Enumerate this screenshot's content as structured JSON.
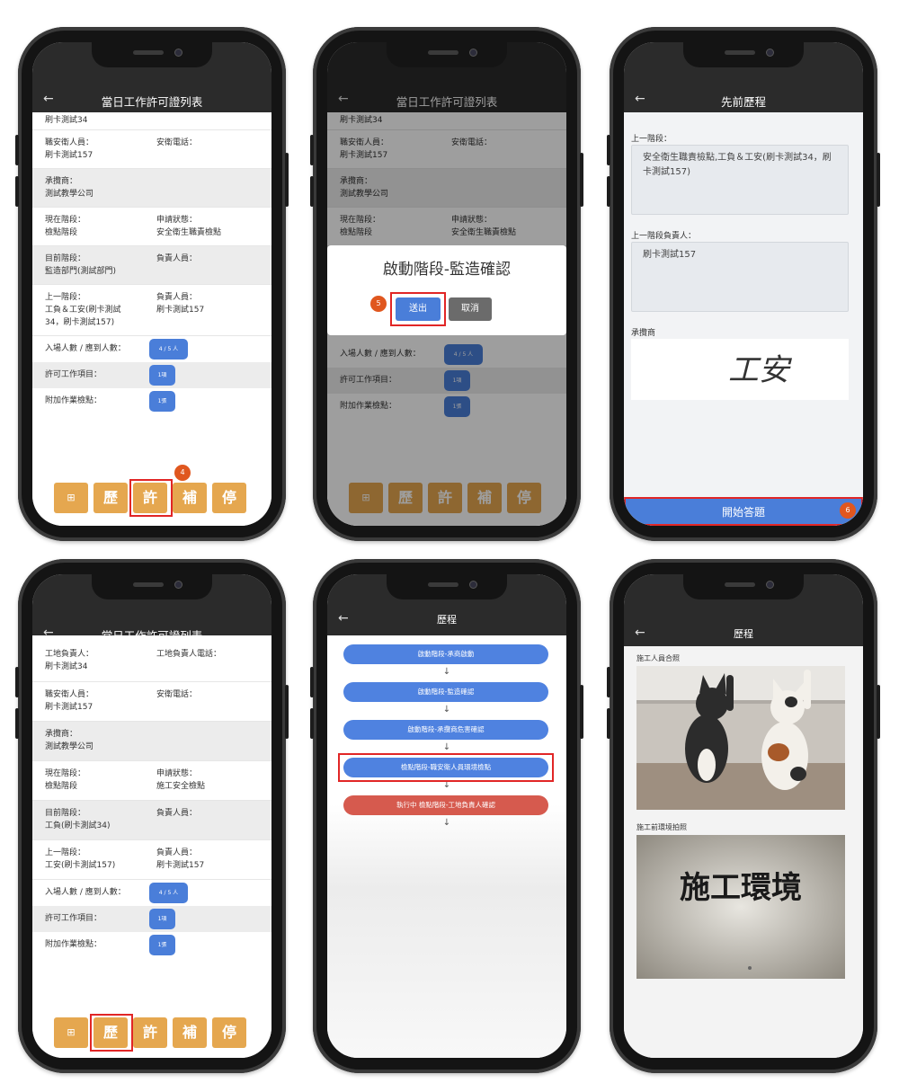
{
  "colors": {
    "accent": "#4a7ed9",
    "toolbar": "#e5a74f",
    "highlight": "#e12626",
    "badge": "#e0571f",
    "danger": "#d65a4e",
    "appbar": "#2b2b2b"
  },
  "common": {
    "back_icon": "←"
  },
  "toolbar": {
    "grid_icon": "⊞",
    "history": "歷",
    "permit": "許",
    "supplement": "補",
    "stop": "停"
  },
  "s1": {
    "title": "當日工作許可證列表",
    "first_line": "刷卡測試34",
    "safety_person_label": "職安衛人員：",
    "safety_person_value": "刷卡測試157",
    "safety_phone_label": "安衛電話：",
    "contractor_label": "承攬商：",
    "contractor_value": "測試教學公司",
    "current_stage_label": "現在階段：",
    "current_stage_value": "檢點階段",
    "apply_status_label": "申請狀態：",
    "apply_status_value": "安全衛生職責檢點",
    "target_stage_label": "目前階段：",
    "target_stage_value": "監造部門(測試部門)",
    "owner_label": "負責人員：",
    "prev_stage_label": "上一階段：",
    "prev_stage_value_1": "工負＆工安(刷卡測試",
    "prev_stage_value_2": "34，刷卡測試157)",
    "prev_owner_label": "負責人員：",
    "prev_owner_value": "刷卡測試157",
    "attendance_label": "入場人數 / 應到人數：",
    "attendance_value": "4 / 5 人",
    "permit_items_label": "許可工作項目：",
    "permit_items_value": "1項",
    "extra_check_label": "附加作業檢點：",
    "extra_check_value": "1張",
    "badge": "4"
  },
  "s2": {
    "title": "當日工作許可證列表",
    "first_line": "刷卡測試34",
    "safety_person_label": "職安衛人員：",
    "safety_person_value": "刷卡測試157",
    "safety_phone_label": "安衛電話：",
    "contractor_label": "承攬商：",
    "contractor_value": "測試教學公司",
    "current_stage_label": "現在階段：",
    "current_stage_value": "檢點階段",
    "apply_status_label": "申請狀態：",
    "apply_status_value": "安全衛生職責檢點",
    "attendance_label": "入場人數 / 應到人數：",
    "attendance_value": "4 / 5 人",
    "permit_items_label": "許可工作項目：",
    "permit_items_value": "1項",
    "extra_check_label": "附加作業檢點：",
    "extra_check_value": "1張",
    "dialog_title": "啟動階段-監造確認",
    "submit": "送出",
    "cancel": "取消",
    "badge": "5"
  },
  "s3": {
    "title": "先前歷程",
    "prev_stage_label": "上一階段：",
    "prev_stage_value": "安全衛生職責檢點,工負＆工安(刷卡測試34，刷卡測試157)",
    "prev_owner_label": "上一階段負責人：",
    "prev_owner_value": "刷卡測試157",
    "contractor_label": "承攬商",
    "signature": "工安",
    "start_button": "開始答題",
    "badge": "6"
  },
  "s4": {
    "title": "當日工作許可證列表",
    "site_owner_label": "工地負責人：",
    "site_owner_value": "刷卡測試34",
    "site_phone_label": "工地負責人電話：",
    "safety_person_label": "職安衛人員：",
    "safety_person_value": "刷卡測試157",
    "safety_phone_label": "安衛電話：",
    "contractor_label": "承攬商：",
    "contractor_value": "測試教學公司",
    "current_stage_label": "現在階段：",
    "current_stage_value": "檢點階段",
    "apply_status_label": "申請狀態：",
    "apply_status_value": "施工安全檢點",
    "target_stage_label": "目前階段：",
    "target_stage_value": "工負(刷卡測試34)",
    "owner_label": "負責人員：",
    "prev_stage_label": "上一階段：",
    "prev_stage_value": "工安(刷卡測試157)",
    "prev_owner_label": "負責人員：",
    "prev_owner_value": "刷卡測試157",
    "attendance_label": "入場人數 / 應到人數：",
    "attendance_value": "4 / 5 人",
    "permit_items_label": "許可工作項目：",
    "permit_items_value": "1項",
    "extra_check_label": "附加作業檢點：",
    "extra_check_value": "1張"
  },
  "s5": {
    "title": "歷程",
    "steps": [
      "啟動階段-承商啟動",
      "啟動階段-監造確認",
      "啟動階段-承攬商危害確認",
      "檢點階段-職安衛人員環境檢點",
      "執行中 檢點階段-工地負責人確認"
    ],
    "arrow": "↓"
  },
  "s6": {
    "title": "歷程",
    "photo1_label": "施工人員合照",
    "photo2_label": "施工前環境拍照",
    "photo2_text": "施工環境"
  }
}
